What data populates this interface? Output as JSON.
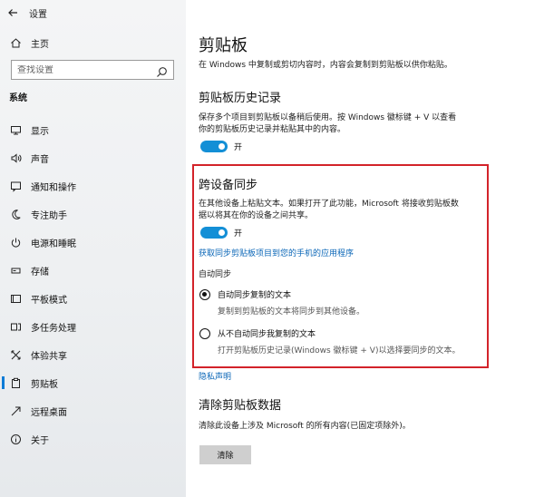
{
  "window": {
    "title": "设置"
  },
  "sidebar": {
    "home_label": "主页",
    "search_placeholder": "查找设置",
    "section_label": "系统",
    "items": [
      {
        "label": "显示",
        "icon": "monitor-icon"
      },
      {
        "label": "声音",
        "icon": "speaker-icon"
      },
      {
        "label": "通知和操作",
        "icon": "notification-icon"
      },
      {
        "label": "专注助手",
        "icon": "moon-icon"
      },
      {
        "label": "电源和睡眠",
        "icon": "power-icon"
      },
      {
        "label": "存储",
        "icon": "storage-icon"
      },
      {
        "label": "平板模式",
        "icon": "tablet-icon"
      },
      {
        "label": "多任务处理",
        "icon": "multitask-icon"
      },
      {
        "label": "体验共享",
        "icon": "share-icon"
      },
      {
        "label": "剪贴板",
        "icon": "clipboard-icon",
        "active": true
      },
      {
        "label": "远程桌面",
        "icon": "remote-icon"
      },
      {
        "label": "关于",
        "icon": "info-icon"
      }
    ]
  },
  "main": {
    "page_title": "剪贴板",
    "intro": "在 Windows 中复制或剪切内容时，内容会复制到剪贴板以供你粘贴。",
    "history": {
      "title": "剪贴板历史记录",
      "desc_line1": "保存多个项目到剪贴板以备稍后使用。按 Windows 徽标键 + V 以查看",
      "desc_line2": "你的剪贴板历史记录并粘贴其中的内容。",
      "toggle_label": "开"
    },
    "sync": {
      "title": "跨设备同步",
      "desc_line1": "在其他设备上粘贴文本。如果打开了此功能，Microsoft 将接收剪贴板数",
      "desc_line2": "据以将其在你的设备之间共享。",
      "toggle_label": "开",
      "link": "获取同步剪贴板项目到您的手机的应用程序",
      "auto_sync_label": "自动同步",
      "option1_label": "自动同步复制的文本",
      "option1_desc": "复制到剪贴板的文本将同步到其他设备。",
      "option2_label": "从不自动同步我复制的文本",
      "option2_desc": "打开剪贴板历史记录(Windows 徽标键 + V)以选择要同步的文本。"
    },
    "privacy_link": "隐私声明",
    "clear": {
      "title": "清除剪贴板数据",
      "desc": "清除此设备上涉及 Microsoft 的所有内容(已固定项除外)。",
      "button_label": "清除"
    }
  },
  "colors": {
    "accent": "#138fd6",
    "highlight_border": "#d3232a",
    "link": "#0a66b7"
  }
}
